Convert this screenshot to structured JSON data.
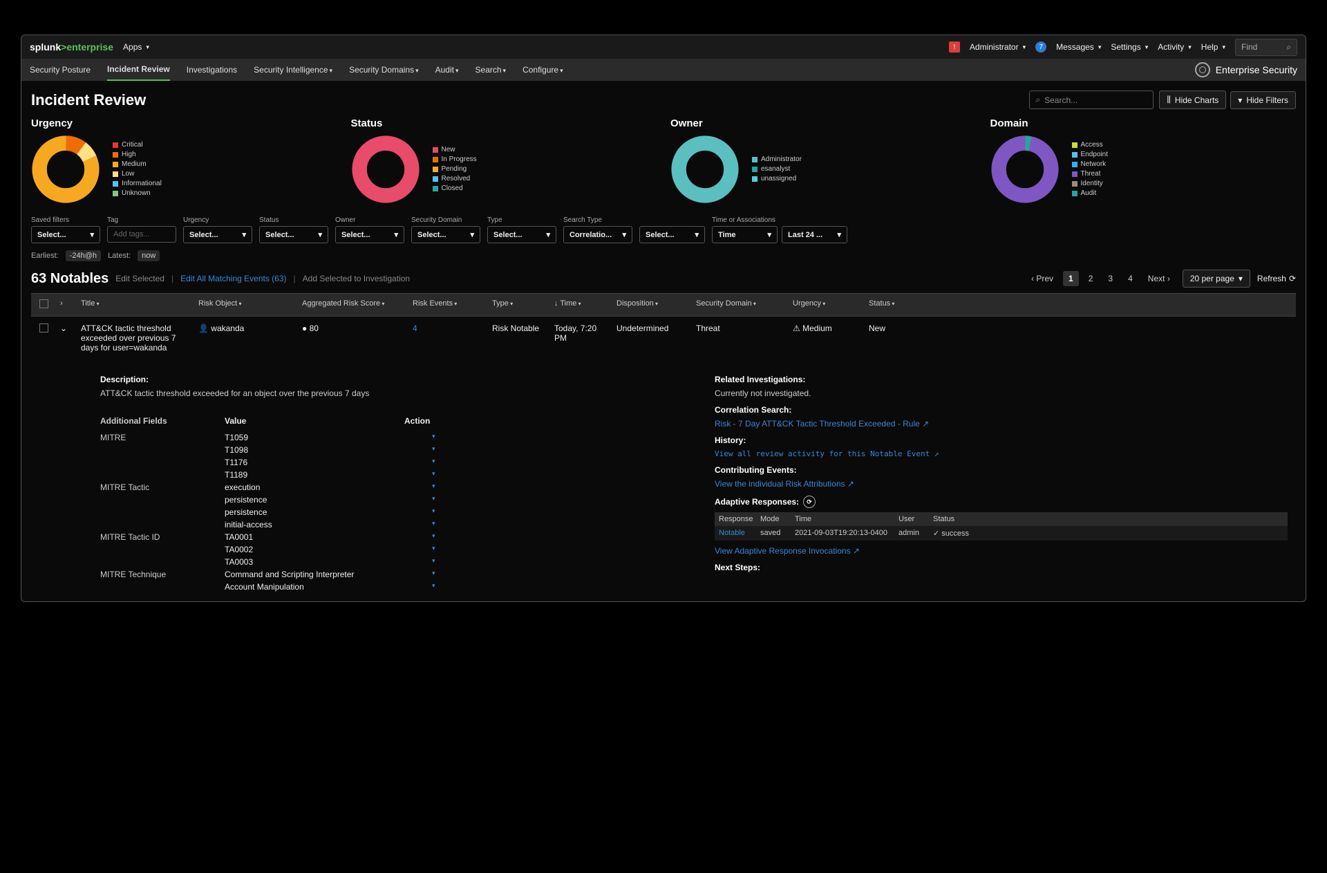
{
  "topbar": {
    "logo1": "splunk",
    "logo2": "enterprise",
    "apps": "Apps",
    "alert_count": "!",
    "admin": "Administrator",
    "msg_count": "7",
    "messages": "Messages",
    "settings": "Settings",
    "activity": "Activity",
    "help": "Help",
    "find": "Find"
  },
  "nav": {
    "items": [
      "Security Posture",
      "Incident Review",
      "Investigations",
      "Security Intelligence",
      "Security Domains",
      "Audit",
      "Search",
      "Configure"
    ],
    "app": "Enterprise Security"
  },
  "page": {
    "title": "Incident Review",
    "search_ph": "Search...",
    "hide_charts": "Hide Charts",
    "hide_filters": "Hide Filters"
  },
  "charts": {
    "urgency": {
      "title": "Urgency",
      "legend": [
        "Critical",
        "High",
        "Medium",
        "Low",
        "Informational",
        "Unknown"
      ],
      "colors": [
        "#e53935",
        "#ef6c00",
        "#f6a821",
        "#ffe082",
        "#4fc3f7",
        "#81c784"
      ]
    },
    "status": {
      "title": "Status",
      "legend": [
        "New",
        "In Progress",
        "Pending",
        "Resolved",
        "Closed"
      ],
      "colors": [
        "#e94b6a",
        "#ef6c00",
        "#f6a821",
        "#4fc3f7",
        "#26a69a"
      ]
    },
    "owner": {
      "title": "Owner",
      "legend": [
        "Administrator",
        "esanalyst",
        "unassigned"
      ],
      "colors": [
        "#5bbfbf",
        "#26a69a",
        "#4dd0e1"
      ]
    },
    "domain": {
      "title": "Domain",
      "legend": [
        "Access",
        "Endpoint",
        "Network",
        "Threat",
        "Identity",
        "Audit"
      ],
      "colors": [
        "#cddc39",
        "#4fc3f7",
        "#29b6f6",
        "#7e57c2",
        "#a1887f",
        "#26a69a"
      ]
    }
  },
  "filters": {
    "saved": {
      "label": "Saved filters",
      "value": "Select..."
    },
    "tag": {
      "label": "Tag",
      "placeholder": "Add tags..."
    },
    "urgency": {
      "label": "Urgency",
      "value": "Select..."
    },
    "status": {
      "label": "Status",
      "value": "Select..."
    },
    "owner": {
      "label": "Owner",
      "value": "Select..."
    },
    "secdom": {
      "label": "Security Domain",
      "value": "Select..."
    },
    "type": {
      "label": "Type",
      "value": "Select..."
    },
    "searchtype": {
      "label": "Search Type",
      "value": "Correlatio..."
    },
    "blank": {
      "value": "Select..."
    },
    "timeassoc": {
      "label": "Time or Associations",
      "value": "Time"
    },
    "last": {
      "value": "Last 24 ..."
    }
  },
  "timerow": {
    "earliest_l": "Earliest:",
    "earliest_v": "-24h@h",
    "latest_l": "Latest:",
    "latest_v": "now"
  },
  "notables": {
    "count": "63 Notables",
    "edit_sel": "Edit Selected",
    "edit_all": "Edit All Matching Events (63)",
    "add_inv": "Add Selected to Investigation",
    "prev": "Prev",
    "next": "Next",
    "pages": [
      "1",
      "2",
      "3",
      "4"
    ],
    "perpage": "20 per page",
    "refresh": "Refresh"
  },
  "columns": {
    "title": "Title",
    "obj": "Risk Object",
    "score": "Aggregated Risk Score",
    "events": "Risk Events",
    "type": "Type",
    "time": "Time",
    "disp": "Disposition",
    "dom": "Security Domain",
    "urg": "Urgency",
    "stat": "Status"
  },
  "row": {
    "title": "ATT&CK tactic threshold exceeded over previous 7 days for user=wakanda",
    "obj": "wakanda",
    "score": "80",
    "events": "4",
    "type": "Risk Notable",
    "time": "Today, 7:20 PM",
    "disp": "Undetermined",
    "dom": "Threat",
    "urg": "Medium",
    "stat": "New"
  },
  "detail": {
    "desc_l": "Description:",
    "desc_v": "ATT&CK tactic threshold exceeded for an object over the previous 7 days",
    "addl": "Additional Fields",
    "value": "Value",
    "action": "Action",
    "fields": [
      {
        "k": "MITRE",
        "v": [
          "T1059",
          "T1098",
          "T1176",
          "T1189"
        ]
      },
      {
        "k": "MITRE Tactic",
        "v": [
          "execution",
          "persistence",
          "persistence",
          "initial-access"
        ]
      },
      {
        "k": "MITRE Tactic ID",
        "v": [
          "TA0001",
          "TA0002",
          "TA0003"
        ]
      },
      {
        "k": "MITRE Technique",
        "v": [
          "Command and Scripting Interpreter",
          "Account Manipulation"
        ]
      }
    ],
    "rel_inv_l": "Related Investigations:",
    "rel_inv_v": "Currently not investigated.",
    "corr_l": "Correlation Search:",
    "corr_v": "Risk - 7 Day ATT&CK Tactic Threshold Exceeded - Rule",
    "hist_l": "History:",
    "hist_v": "View all review activity for this Notable Event",
    "contrib_l": "Contributing Events:",
    "contrib_v": "View the individual Risk Attributions",
    "adapt_l": "Adaptive Responses:",
    "resp_head": {
      "r": "Response",
      "m": "Mode",
      "t": "Time",
      "u": "User",
      "s": "Status"
    },
    "resp_row": {
      "r": "Notable",
      "m": "saved",
      "t": "2021-09-03T19:20:13-0400",
      "u": "admin",
      "s": "success"
    },
    "adapt_link": "View Adaptive Response Invocations",
    "next_l": "Next Steps:"
  },
  "chart_data": [
    {
      "type": "pie",
      "title": "Urgency",
      "categories": [
        "Critical",
        "High",
        "Medium",
        "Low",
        "Informational",
        "Unknown"
      ],
      "values": [
        2,
        10,
        75,
        8,
        3,
        2
      ]
    },
    {
      "type": "pie",
      "title": "Status",
      "categories": [
        "New",
        "In Progress",
        "Pending",
        "Resolved",
        "Closed"
      ],
      "values": [
        98,
        0.5,
        0.5,
        0.5,
        0.5
      ]
    },
    {
      "type": "pie",
      "title": "Owner",
      "categories": [
        "Administrator",
        "esanalyst",
        "unassigned"
      ],
      "values": [
        96,
        2,
        2
      ]
    },
    {
      "type": "pie",
      "title": "Domain",
      "categories": [
        "Access",
        "Endpoint",
        "Network",
        "Threat",
        "Identity",
        "Audit"
      ],
      "values": [
        1,
        1,
        1,
        94,
        1,
        2
      ]
    }
  ]
}
